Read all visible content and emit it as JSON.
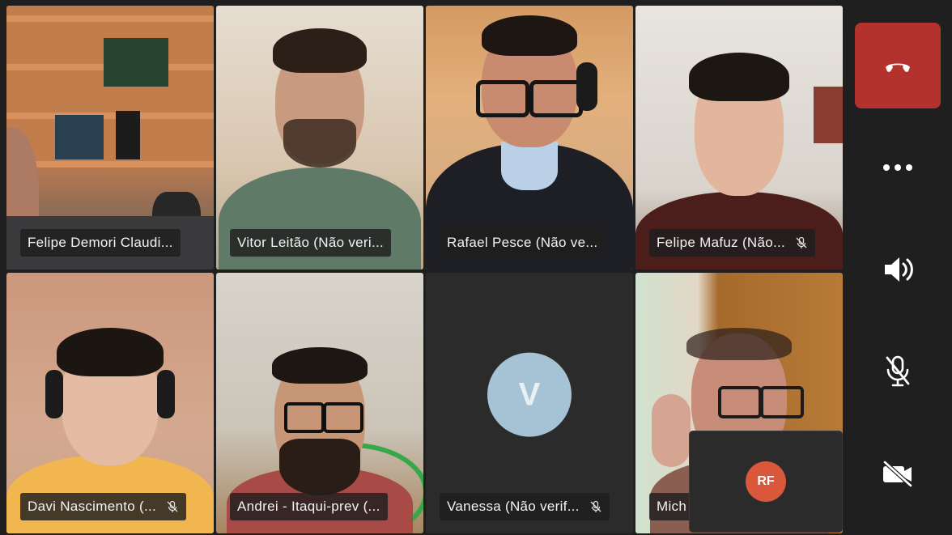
{
  "participants": [
    {
      "name": "Felipe Demori Claudi...",
      "muted": false,
      "active": false
    },
    {
      "name": "Vitor Leitão (Não veri...",
      "muted": false,
      "active": true
    },
    {
      "name": "Rafael Pesce (Não ve...",
      "muted": false,
      "active": true
    },
    {
      "name": "Felipe Mafuz (Não...",
      "muted": true,
      "active": false
    },
    {
      "name": "Davi Nascimento (...",
      "muted": true,
      "active": false
    },
    {
      "name": "Andrei - Itaqui-prev (...",
      "muted": false,
      "active": false
    },
    {
      "name": "Vanessa (Não verif...",
      "muted": true,
      "active": false,
      "avatar_initial": "V"
    },
    {
      "name": "Mich",
      "muted": false,
      "active": false
    }
  ],
  "self_view": {
    "initials": "RF"
  },
  "controls": {
    "hangup": "hang-up-icon",
    "more": "more-options-icon",
    "speaker": "speaker-icon",
    "mic": "mic-off-icon",
    "camera": "camera-off-icon"
  },
  "colors": {
    "active_border": "#6264a7",
    "hangup": "#b3322d",
    "avatar_bg": "#a6c3d6",
    "self_avatar_bg": "#d9573a"
  }
}
